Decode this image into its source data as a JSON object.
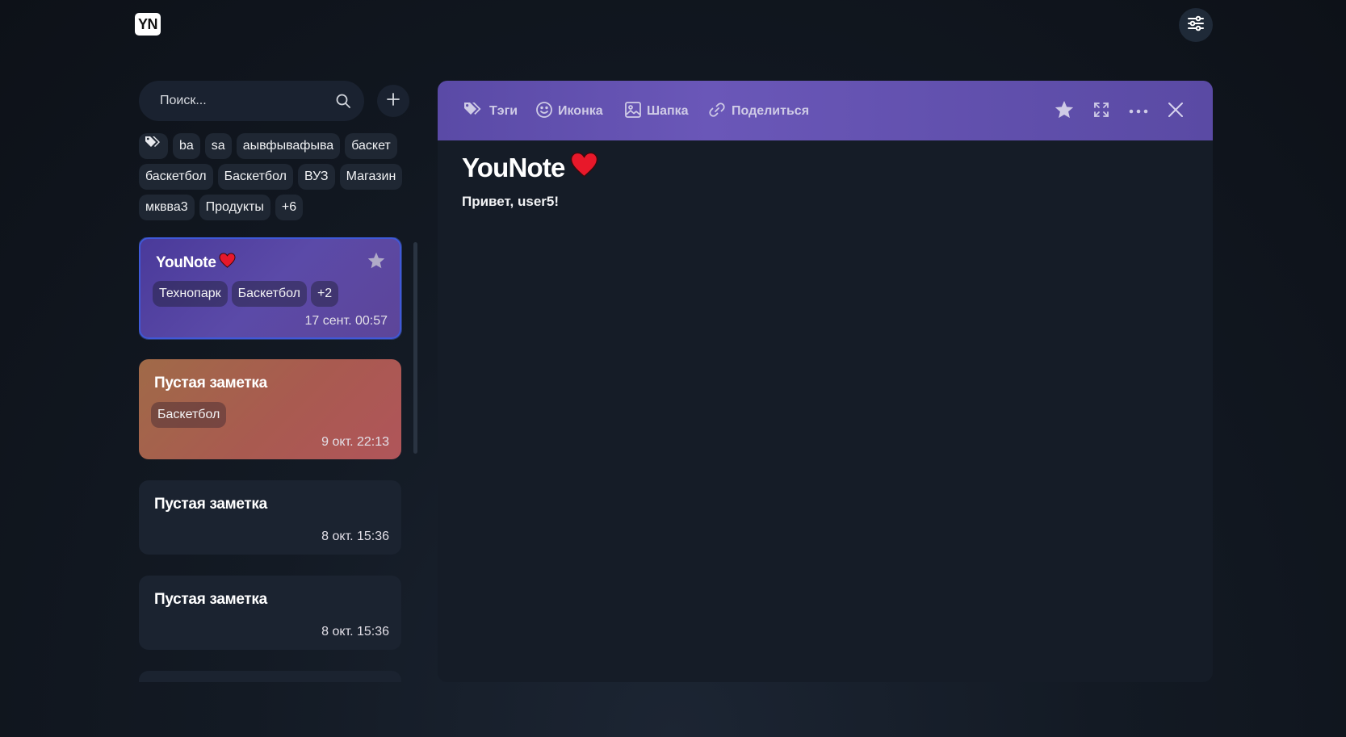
{
  "app": {
    "logo_text": "YN"
  },
  "search": {
    "placeholder": "Поиск..."
  },
  "tags": [
    "ba",
    "sa",
    "аывфывафыва",
    "баскет",
    "баскетбол",
    "Баскетбол",
    "ВУЗ",
    "Магазин",
    "мквва3",
    "Продукты",
    "+6"
  ],
  "notes": [
    {
      "title": "YouNote",
      "chips": [
        "Технопарк",
        "Баскетбол",
        "+2"
      ],
      "date": "17 сент. 00:57",
      "favorite": true
    },
    {
      "title": "Пустая заметка",
      "chips": [
        "Баскетбол"
      ],
      "date": "9 окт. 22:13"
    },
    {
      "title": "Пустая заметка",
      "chips": [],
      "date": "8 окт. 15:36"
    },
    {
      "title": "Пустая заметка",
      "chips": [],
      "date": "8 окт. 15:36"
    }
  ],
  "editor": {
    "toolbar": {
      "tags": "Тэги",
      "icon": "Иконка",
      "header": "Шапка",
      "share": "Поделиться"
    },
    "title": "YouNote",
    "body": "Привет, user5!"
  },
  "colors": {
    "accent": "#5b4aa8",
    "selected_border": "#3f59d8",
    "background": "#131a24"
  },
  "icons": [
    "settings-sliders-icon",
    "search-icon",
    "plus-icon",
    "tag-icon",
    "star-icon",
    "heart-icon",
    "smile-icon",
    "image-icon",
    "link-icon",
    "fullscreen-icon",
    "more-icon",
    "close-icon"
  ]
}
